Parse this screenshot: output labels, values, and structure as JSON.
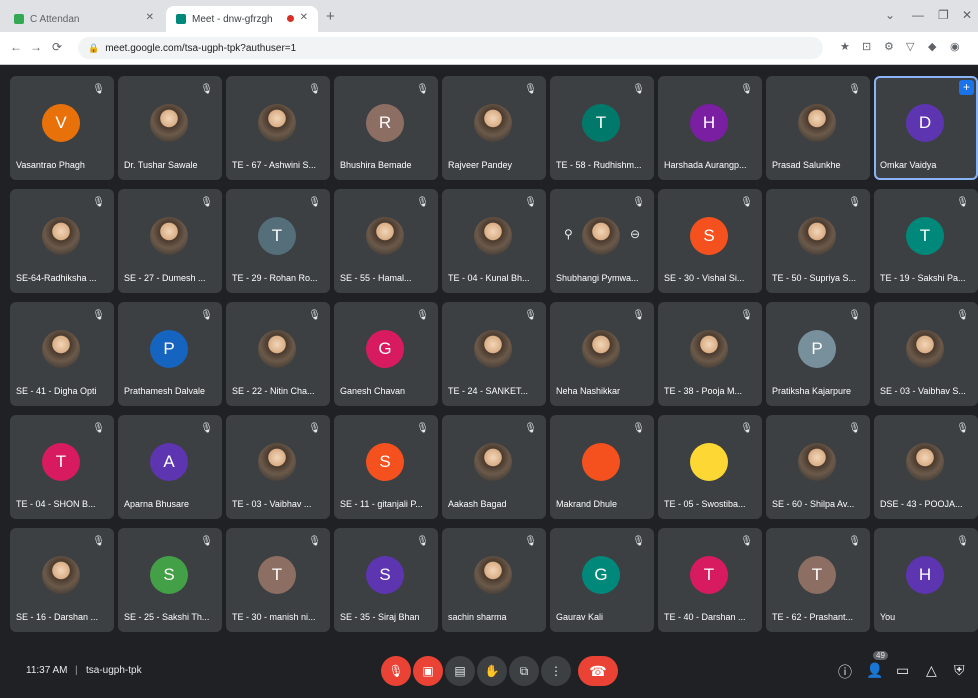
{
  "browser": {
    "tabs": [
      {
        "title": "C Attendan",
        "favicon_color": "#34a853"
      },
      {
        "title": "Meet - dnw-gfrzgh",
        "favicon_color": "#00897b"
      }
    ],
    "new_tab": "+",
    "window_buttons": [
      "⌄",
      "—",
      "❐",
      "✕"
    ],
    "nav": [
      "←",
      "→",
      "⟳"
    ],
    "url": "meet.google.com/tsa-ugph-tpk?authuser=1",
    "extensions": [
      "★",
      "⊡",
      "⚙",
      "▽",
      "◆",
      "◉"
    ]
  },
  "participants": [
    {
      "name": "Vasantrao Phagh",
      "initial": "V",
      "color": "#e8710a"
    },
    {
      "name": "Dr. Tushar Sawale",
      "initial": "",
      "color": "photo"
    },
    {
      "name": "TE - 67 - Ashwini S...",
      "initial": "",
      "color": "photo"
    },
    {
      "name": "Bhushira Bemade",
      "initial": "R",
      "color": "#8d6e63"
    },
    {
      "name": "Rajveer Pandey",
      "initial": "",
      "color": "photo"
    },
    {
      "name": "TE - 58 - Rudhishm...",
      "initial": "T",
      "color": "#00796b"
    },
    {
      "name": "Harshada Aurangp...",
      "initial": "H",
      "color": "#7b1fa2"
    },
    {
      "name": "Prasad Salunkhe",
      "initial": "",
      "color": "photo"
    },
    {
      "name": "Omkar Vaidya",
      "initial": "D",
      "color": "#5e35b1",
      "active": true
    },
    {
      "name": "SE-64-Radhiksha ...",
      "initial": "",
      "color": "photo"
    },
    {
      "name": "SE - 27 - Dumesh ...",
      "initial": "",
      "color": "photo"
    },
    {
      "name": "TE - 29 - Rohan Ro...",
      "initial": "T",
      "color": "#546e7a"
    },
    {
      "name": "SE - 55 - Hamal...",
      "initial": "",
      "color": "photo"
    },
    {
      "name": "TE - 04 - Kunal Bh...",
      "initial": "",
      "color": "photo"
    },
    {
      "name": "Shubhangi Pymwa...",
      "initial": "",
      "color": "photo",
      "hover": true
    },
    {
      "name": "SE - 30 - Vishal Si...",
      "initial": "S",
      "color": "#f4511e"
    },
    {
      "name": "TE - 50 - Supriya S...",
      "initial": "",
      "color": "photo"
    },
    {
      "name": "TE - 19 - Sakshi Pa...",
      "initial": "T",
      "color": "#00897b"
    },
    {
      "name": "SE - 41 - Digha Opti",
      "initial": "",
      "color": "photo"
    },
    {
      "name": "Prathamesh Dalvale",
      "initial": "P",
      "color": "#1565c0"
    },
    {
      "name": "SE - 22 - Nitin Cha...",
      "initial": "",
      "color": "photo"
    },
    {
      "name": "Ganesh Chavan",
      "initial": "G",
      "color": "#d81b60"
    },
    {
      "name": "TE - 24 - SANKET...",
      "initial": "",
      "color": "photo"
    },
    {
      "name": "Neha Nashikkar",
      "initial": "",
      "color": "photo"
    },
    {
      "name": "TE - 38 - Pooja M...",
      "initial": "",
      "color": "photo"
    },
    {
      "name": "Pratiksha Kajarpure",
      "initial": "P",
      "color": "#78909c"
    },
    {
      "name": "SE - 03 - Vaibhav S...",
      "initial": "",
      "color": "photo"
    },
    {
      "name": "TE - 04 - SHON B...",
      "initial": "T",
      "color": "#d81b60"
    },
    {
      "name": "Aparna Bhusare",
      "initial": "A",
      "color": "#5e35b1"
    },
    {
      "name": "TE - 03 - Vaibhav ...",
      "initial": "",
      "color": "photo"
    },
    {
      "name": "SE - 11 - gitanjali P...",
      "initial": "S",
      "color": "#f4511e"
    },
    {
      "name": "Aakash Bagad",
      "initial": "",
      "color": "photo"
    },
    {
      "name": "Makrand Dhule",
      "initial": "",
      "color": "#f4511e"
    },
    {
      "name": "TE - 05 - Swostiba...",
      "initial": "",
      "color": "#fdd835"
    },
    {
      "name": "SE - 60 - Shilpa Av...",
      "initial": "",
      "color": "photo"
    },
    {
      "name": "DSE - 43 - POOJA...",
      "initial": "",
      "color": "photo"
    },
    {
      "name": "SE - 16 - Darshan ...",
      "initial": "",
      "color": "photo"
    },
    {
      "name": "SE - 25 - Sakshi Th...",
      "initial": "S",
      "color": "#43a047"
    },
    {
      "name": "TE - 30 - manish ni...",
      "initial": "T",
      "color": "#8d6e63"
    },
    {
      "name": "SE - 35 - Siraj Bhan",
      "initial": "S",
      "color": "#5e35b1"
    },
    {
      "name": "sachin sharma",
      "initial": "",
      "color": "photo"
    },
    {
      "name": "Gaurav Kali",
      "initial": "G",
      "color": "#00897b"
    },
    {
      "name": "TE - 40 - Darshan ...",
      "initial": "T",
      "color": "#d81b60"
    },
    {
      "name": "TE - 62 - Prashant...",
      "initial": "T",
      "color": "#8d6e63"
    },
    {
      "name": "You",
      "initial": "H",
      "color": "#5e35b1"
    }
  ],
  "bottom_bar": {
    "time": "11:37 AM",
    "separator": "|",
    "meeting_code": "tsa-ugph-tpk",
    "participant_count": "49"
  }
}
